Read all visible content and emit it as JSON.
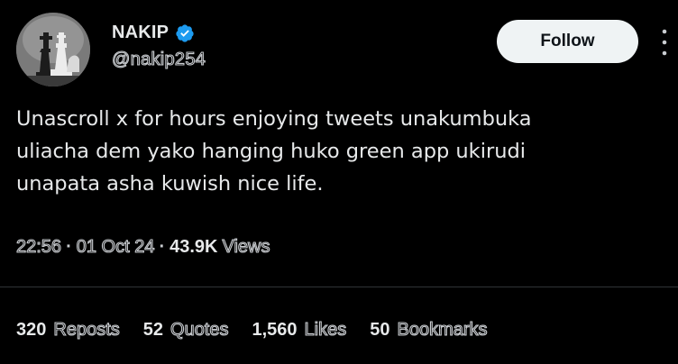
{
  "author": {
    "display_name": "NAKIP",
    "handle": "@nakip254",
    "verified": true,
    "verified_color": "#1d9bf0"
  },
  "actions": {
    "follow_label": "Follow",
    "more_icon": "more-vertical-icon"
  },
  "tweet": {
    "lines": [
      "Unascroll x for hours enjoying tweets unakumbuka",
      "uliacha dem yako hanging huko green app ukirudi",
      "unapata asha kuwish nice life."
    ],
    "time": "22:56",
    "date": "01 Oct 24",
    "separator": "·",
    "views_count": "43.9K",
    "views_label": "Views"
  },
  "stats": {
    "reposts": {
      "count": "320",
      "label": "Reposts"
    },
    "quotes": {
      "count": "52",
      "label": "Quotes"
    },
    "likes": {
      "count": "1,560",
      "label": "Likes"
    },
    "bookmarks": {
      "count": "50",
      "label": "Bookmarks"
    }
  },
  "colors": {
    "background": "#000000",
    "text_primary": "#e7e9ea",
    "button_bg": "#eff3f4",
    "divider": "#2f3336"
  }
}
